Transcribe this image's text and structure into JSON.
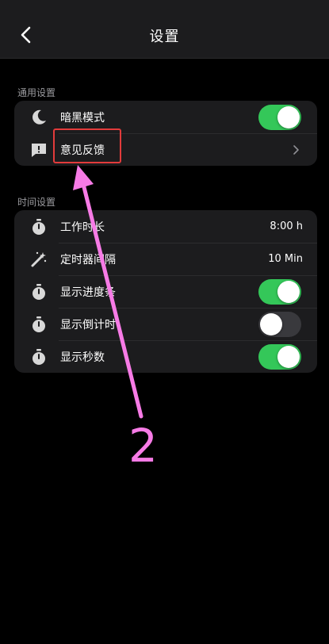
{
  "header": {
    "title": "设置"
  },
  "general": {
    "section_label": "通用设置",
    "dark_mode": {
      "label": "暗黑模式",
      "enabled": true
    },
    "feedback": {
      "label": "意见反馈"
    }
  },
  "time": {
    "section_label": "时间设置",
    "rows": [
      {
        "label": "工作时长",
        "value": "8:00 h",
        "icon": "stopwatch-icon"
      },
      {
        "label": "定时器间隔",
        "value": "10 Min",
        "icon": "magic-wand-icon"
      },
      {
        "label": "显示进度条",
        "enabled": true,
        "icon": "stopwatch-icon"
      },
      {
        "label": "显示倒计时",
        "enabled": false,
        "icon": "stopwatch-icon"
      },
      {
        "label": "显示秒数",
        "enabled": true,
        "icon": "stopwatch-icon"
      }
    ]
  },
  "annotation": {
    "number": "2"
  },
  "colors": {
    "background": "#000000",
    "card": "#1c1c1e",
    "toggle_on": "#34c759",
    "toggle_off": "#39393d",
    "highlight": "#e23b3b",
    "arrow": "#f77be6"
  }
}
